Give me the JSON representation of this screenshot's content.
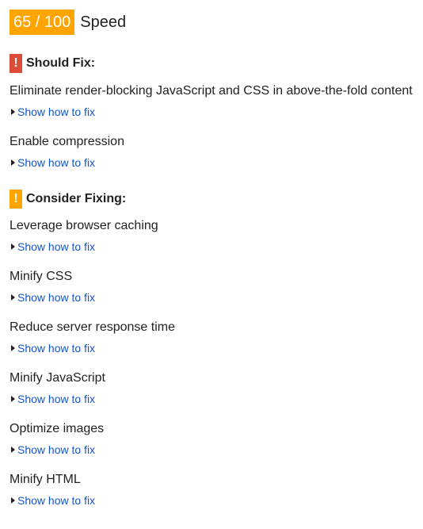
{
  "score": {
    "value": "65 / 100",
    "label": "Speed",
    "badge_color": "#ffa400"
  },
  "sections": [
    {
      "icon": "exclamation-icon",
      "icon_text": "!",
      "color": "#dd4b39",
      "title": "Should Fix:",
      "rules": [
        {
          "title": "Eliminate render-blocking JavaScript and CSS in above-the-fold content",
          "link": "Show how to fix"
        },
        {
          "title": "Enable compression",
          "link": "Show how to fix"
        }
      ]
    },
    {
      "icon": "exclamation-icon",
      "icon_text": "!",
      "color": "#ffa400",
      "title": "Consider Fixing:",
      "rules": [
        {
          "title": "Leverage browser caching",
          "link": "Show how to fix"
        },
        {
          "title": "Minify CSS",
          "link": "Show how to fix"
        },
        {
          "title": "Reduce server response time",
          "link": "Show how to fix"
        },
        {
          "title": "Minify JavaScript",
          "link": "Show how to fix"
        },
        {
          "title": "Optimize images",
          "link": "Show how to fix"
        },
        {
          "title": "Minify HTML",
          "link": "Show how to fix"
        }
      ]
    }
  ]
}
